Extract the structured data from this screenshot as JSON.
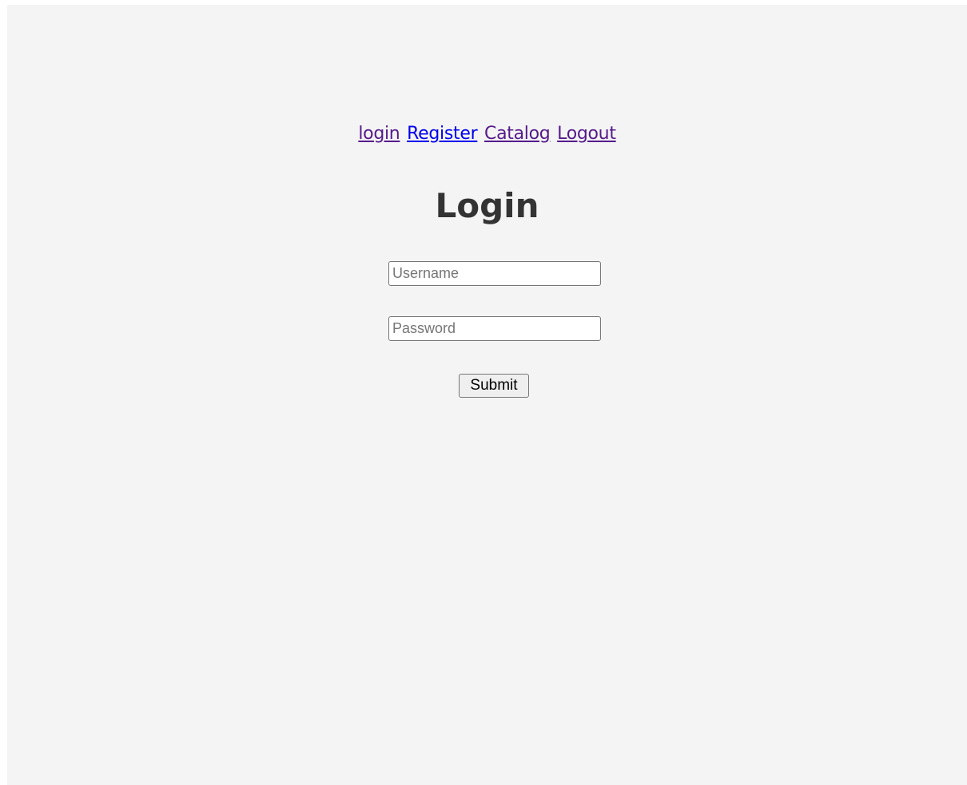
{
  "nav": {
    "links": [
      {
        "label": "login",
        "state": "visited"
      },
      {
        "label": "Register",
        "state": "unvisited"
      },
      {
        "label": "Catalog",
        "state": "visited"
      },
      {
        "label": "Logout",
        "state": "visited"
      }
    ]
  },
  "page": {
    "title": "Login"
  },
  "form": {
    "username": {
      "placeholder": "Username",
      "value": ""
    },
    "password": {
      "placeholder": "Password",
      "value": ""
    },
    "submit_label": "Submit"
  },
  "colors": {
    "background": "#f4f4f4",
    "link_visited": "#551a8b",
    "link_unvisited": "#0000ee",
    "title": "#333333"
  }
}
